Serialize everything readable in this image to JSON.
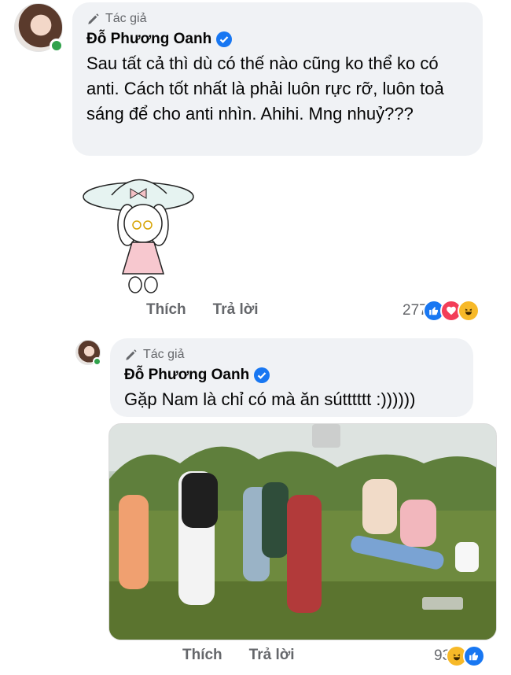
{
  "comment1": {
    "author_badge": "Tác giả",
    "author_name": "Đỗ Phương Oanh",
    "text": "Sau tất cả thì dù có thế nào cũng ko thể ko có anti. Cách tốt nhất là phải luôn rực rỡ, luôn toả sáng để cho anti nhìn. Ahihi. Mng nhuỷ???",
    "like_label": "Thích",
    "reply_label": "Trả lời",
    "reaction_count": "277",
    "reactions": [
      "like-icon",
      "love-icon",
      "haha-icon"
    ]
  },
  "comment2": {
    "author_badge": "Tác giả",
    "author_name": "Đỗ Phương Oanh",
    "text": "Gặp Nam là chỉ có mà ăn sútttttt :))))))",
    "like_label": "Thích",
    "reply_label": "Trả lời",
    "reaction_count": "93",
    "reactions": [
      "haha-icon",
      "like-icon"
    ]
  },
  "colors": {
    "bubble": "#f0f2f5",
    "secondary_text": "#65676b",
    "verified_blue": "#1877f2",
    "online_green": "#31a24c"
  }
}
